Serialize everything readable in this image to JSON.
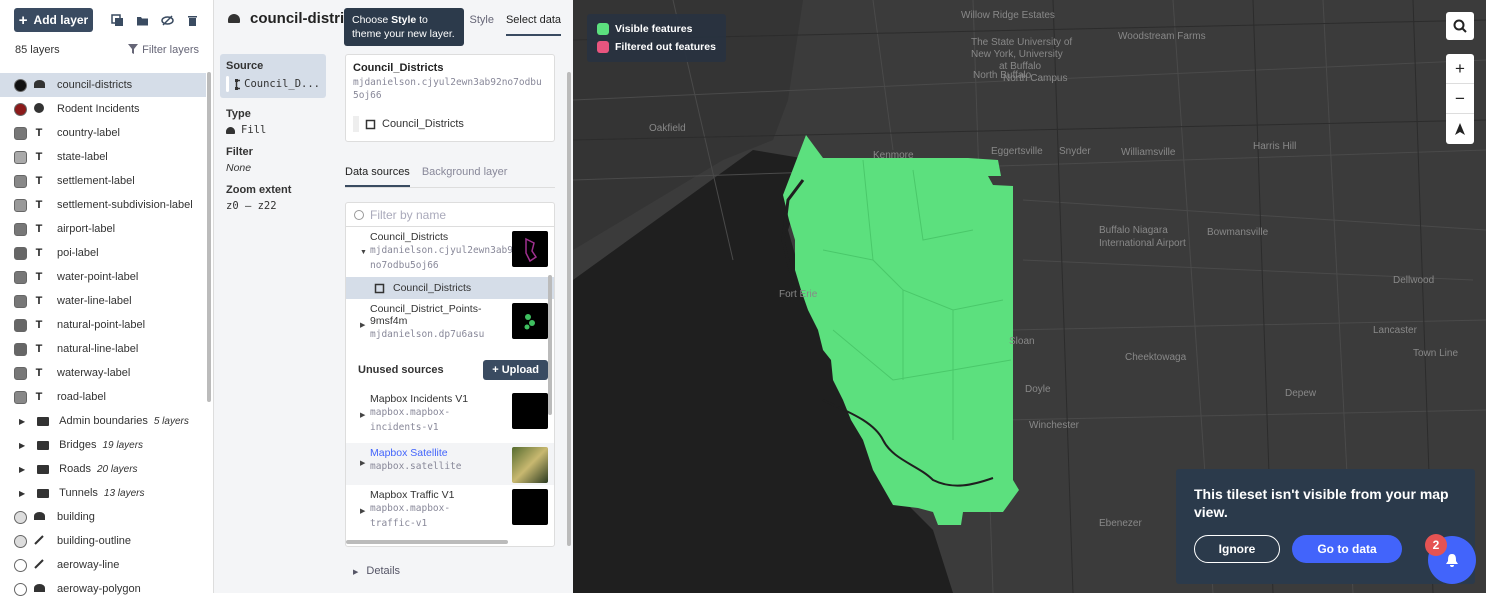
{
  "layers_panel": {
    "add_layer_label": "Add layer",
    "count_label": "85 layers",
    "filter_label": "Filter layers",
    "items": [
      {
        "name": "council-districts",
        "type": "fill",
        "color": "#111111",
        "selected": true
      },
      {
        "name": "Rodent Incidents",
        "type": "circle",
        "color": "#8b1a1a"
      },
      {
        "name": "country-label",
        "type": "symbol",
        "color": "#777777"
      },
      {
        "name": "state-label",
        "type": "symbol",
        "color": "#aaaaaa"
      },
      {
        "name": "settlement-label",
        "type": "symbol",
        "color": "#888888"
      },
      {
        "name": "settlement-subdivision-label",
        "type": "symbol",
        "color": "#999999"
      },
      {
        "name": "airport-label",
        "type": "symbol",
        "color": "#777777"
      },
      {
        "name": "poi-label",
        "type": "symbol",
        "color": "#666666"
      },
      {
        "name": "water-point-label",
        "type": "symbol",
        "color": "#777777"
      },
      {
        "name": "water-line-label",
        "type": "symbol",
        "color": "#777777"
      },
      {
        "name": "natural-point-label",
        "type": "symbol",
        "color": "#666666"
      },
      {
        "name": "natural-line-label",
        "type": "symbol",
        "color": "#666666"
      },
      {
        "name": "waterway-label",
        "type": "symbol",
        "color": "#777777"
      },
      {
        "name": "road-label",
        "type": "symbol",
        "color": "#888888"
      }
    ],
    "groups": [
      {
        "name": "Admin boundaries",
        "count": "5 layers"
      },
      {
        "name": "Bridges",
        "count": "19 layers"
      },
      {
        "name": "Roads",
        "count": "20 layers"
      },
      {
        "name": "Tunnels",
        "count": "13 layers"
      }
    ],
    "bottom_items": [
      {
        "name": "building",
        "type": "fill",
        "color": "#dddddd"
      },
      {
        "name": "building-outline",
        "type": "line",
        "color": "#dddddd"
      },
      {
        "name": "aeroway-line",
        "type": "line",
        "color": "#ffffff"
      },
      {
        "name": "aeroway-polygon",
        "type": "fill",
        "color": "#ffffff"
      }
    ]
  },
  "editor": {
    "title": "council-districts",
    "tabs": [
      "Style",
      "Select data"
    ],
    "tooltip_pre": "Choose ",
    "tooltip_bold": "Style",
    "tooltip_post": " to theme your new layer.",
    "source_label": "Source",
    "source_value": "Council_D...",
    "type_label": "Type",
    "type_value": "Fill",
    "filter_label": "Filter",
    "filter_value": "None",
    "zoom_label": "Zoom extent",
    "zoom_value": "z0 — z22",
    "source_card": {
      "name": "Council_Districts",
      "id": "mjdanielson.cjyul2ewn3ab92no7odbu5oj66",
      "layer": "Council_Districts"
    },
    "ds_tabs": [
      "Data sources",
      "Background layer"
    ],
    "search_placeholder": "Filter by name",
    "sources": [
      {
        "name": "Council_Districts",
        "id": "mjdanielson.cjyul2ewn3ab92no7odbu5oj66",
        "sublayer": "Council_Districts"
      },
      {
        "name": "Council_District_Points-9msf4m",
        "id": "mjdanielson.dp7u6asu"
      }
    ],
    "unused_label": "Unused sources",
    "upload_label": "Upload",
    "unused_sources": [
      {
        "name": "Mapbox Incidents V1",
        "id": "mapbox.mapbox-incidents-v1"
      },
      {
        "name": "Mapbox Satellite",
        "id": "mapbox.satellite",
        "link": true
      },
      {
        "name": "Mapbox Traffic V1",
        "id": "mapbox.mapbox-traffic-v1"
      }
    ],
    "details_label": "Details"
  },
  "map": {
    "legend": [
      {
        "label": "Visible features",
        "color": "#5ce07e"
      },
      {
        "label": "Filtered out features",
        "color": "#e8557f"
      }
    ],
    "labels": [
      "Willow Ridge Estates",
      "The State University of",
      "New York, University",
      "at Buffalo",
      "North Campus",
      "North Buffalo",
      "Woodstream Farms",
      "Kenmore",
      "Eggertsville",
      "Snyder",
      "Williamsville",
      "Harris Hill",
      "Oakfield",
      "Fort Erie",
      "Buffalo Niagara",
      "International Airport",
      "Bowmansville",
      "Sloan",
      "Cheektowaga",
      "Lancaster",
      "Depew",
      "Doyle",
      "Winchester",
      "Dellwood",
      "Ebenezer",
      "Town Line"
    ],
    "notice_text": "This tileset isn't visible from your map view.",
    "ignore_label": "Ignore",
    "goto_label": "Go to data",
    "notification_count": "2"
  }
}
